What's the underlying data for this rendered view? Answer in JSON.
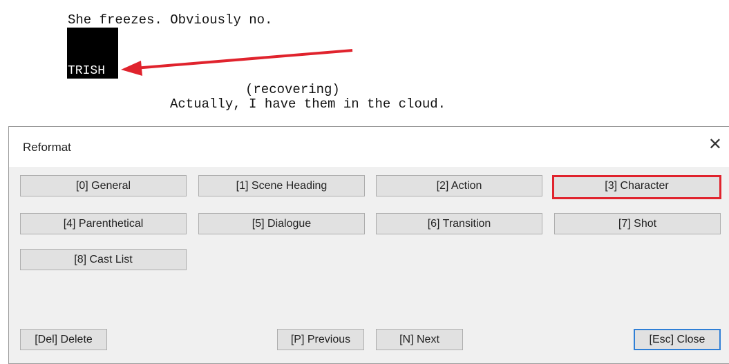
{
  "script": {
    "action": "She freezes. Obviously no.",
    "character": "TRISH",
    "parenthetical": "(recovering)",
    "dialogue": "Actually, I have them in the cloud."
  },
  "dialog": {
    "title": "Reformat",
    "close_glyph": "✕",
    "element_buttons": [
      {
        "label": "[0] General"
      },
      {
        "label": "[1] Scene Heading"
      },
      {
        "label": "[2] Action"
      },
      {
        "label": "[3] Character"
      },
      {
        "label": "[4] Parenthetical"
      },
      {
        "label": "[5] Dialogue"
      },
      {
        "label": "[6] Transition"
      },
      {
        "label": "[7] Shot"
      },
      {
        "label": "[8] Cast List"
      }
    ],
    "footer": {
      "delete_label": "[Del] Delete",
      "previous_label": "[P] Previous",
      "next_label": "[N] Next",
      "close_label": "[Esc] Close"
    }
  },
  "colors": {
    "highlight": "#e0232d",
    "arrow": "#e0232d",
    "selection": "#000000"
  }
}
